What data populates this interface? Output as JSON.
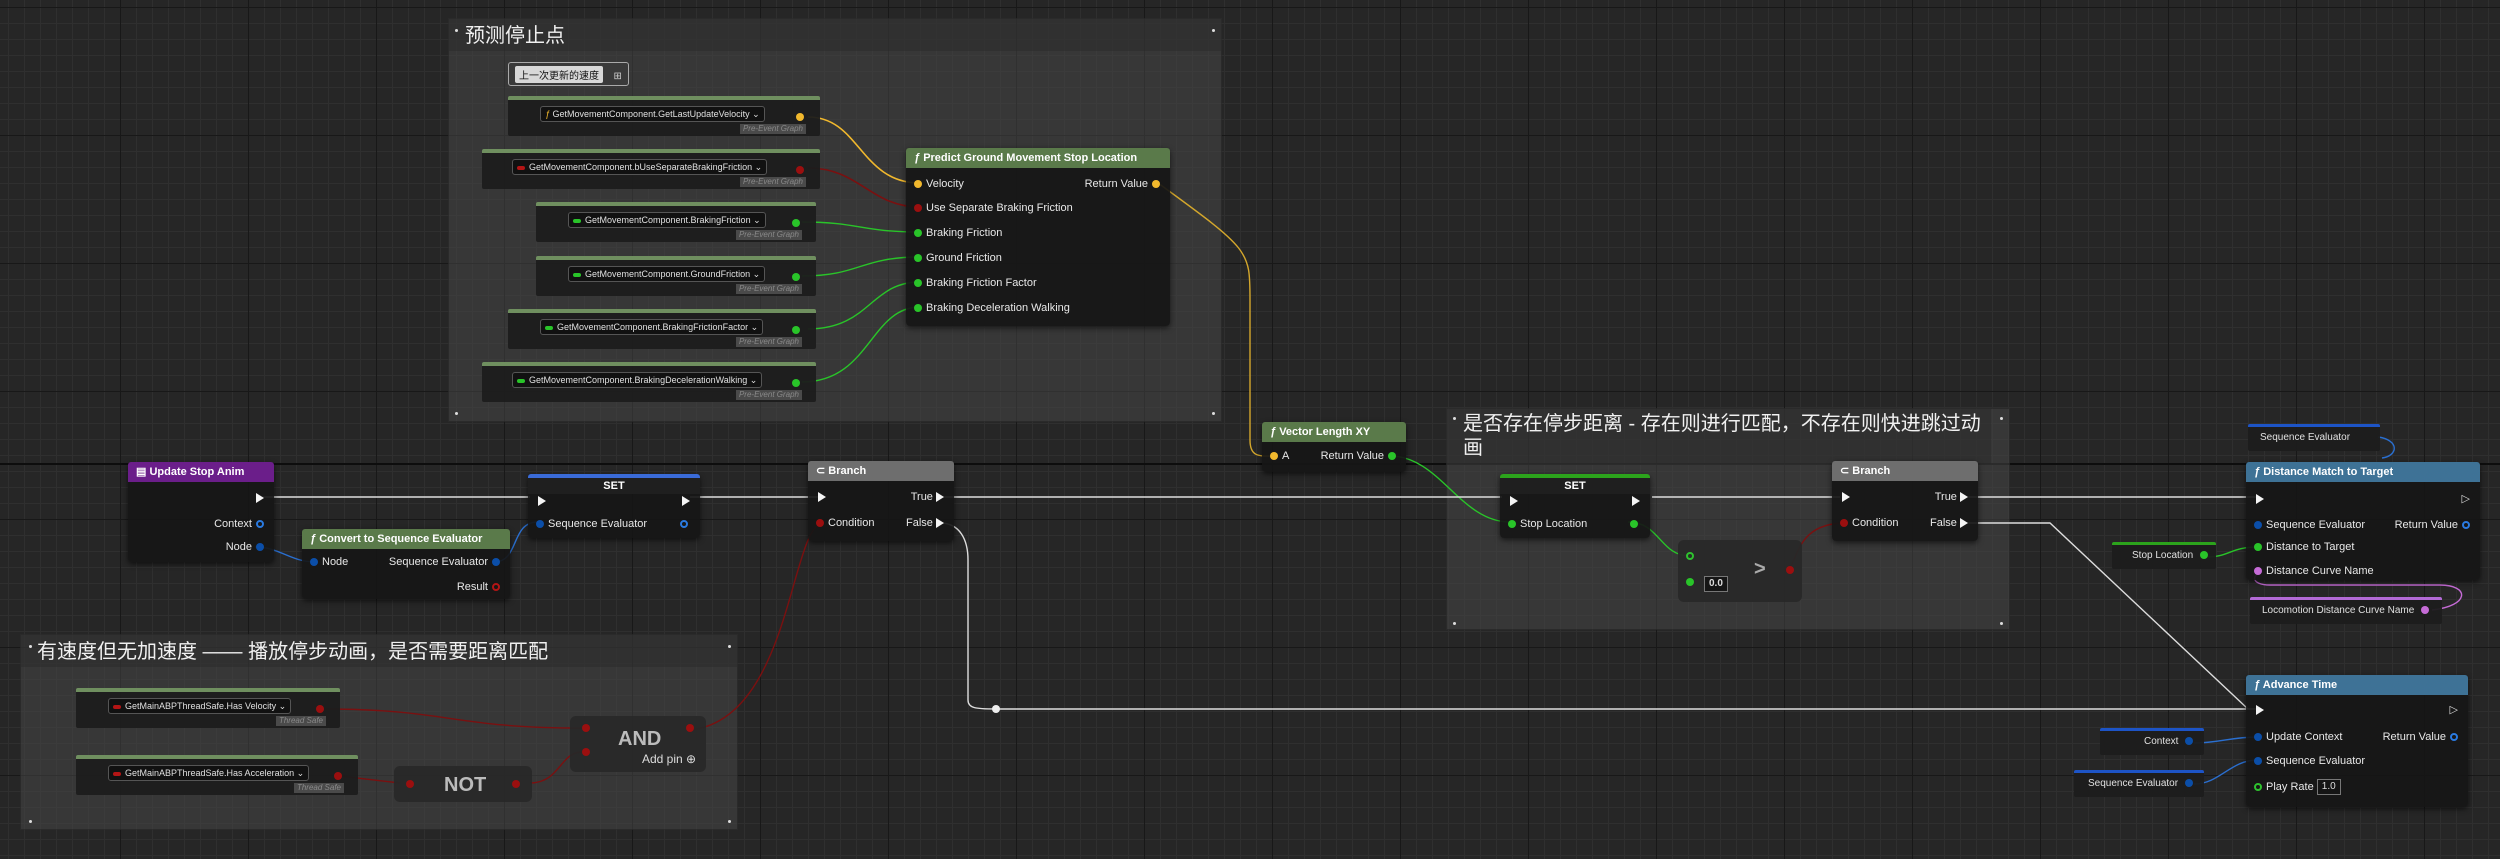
{
  "comments": {
    "predict": "预测停止点",
    "distance": "是否存在停步距离 - 存在则进行匹配，不存在则快进跳过动画",
    "speed": "有速度但无加速度 —— 播放停步动画，是否需要距离匹配"
  },
  "tooltip": "上一次更新的速度",
  "getters": {
    "velocity": "GetMovementComponent.GetLastUpdateVelocity",
    "separate": "GetMovementComponent.bUseSeparateBrakingFriction",
    "braking_friction": "GetMovementComponent.BrakingFriction",
    "ground_friction": "GetMovementComponent.GroundFriction",
    "friction_factor": "GetMovementComponent.BrakingFrictionFactor",
    "decel_walking": "GetMovementComponent.BrakingDecelerationWalking",
    "has_velocity": "GetMainABPThreadSafe.Has Velocity",
    "has_accel": "GetMainABPThreadSafe.Has Acceleration",
    "pre_event": "Pre-Event Graph",
    "thread_safe": "Thread Safe"
  },
  "predict_node": {
    "title": "Predict Ground Movement Stop Location",
    "inputs": [
      "Velocity",
      "Use Separate Braking Friction",
      "Braking Friction",
      "Ground Friction",
      "Braking Friction Factor",
      "Braking Deceleration Walking"
    ],
    "output": "Return Value"
  },
  "vector_length": {
    "title": "Vector Length XY",
    "input": "A",
    "output": "Return Value"
  },
  "update_stop": {
    "title": "Update Stop Anim",
    "context": "Context",
    "node": "Node"
  },
  "convert": {
    "title": "Convert to Sequence Evaluator",
    "node": "Node",
    "output": "Sequence Evaluator",
    "result": "Result"
  },
  "set1": {
    "title": "SET",
    "pin": "Sequence Evaluator"
  },
  "branch1": {
    "title": "Branch",
    "condition": "Condition",
    "true": "True",
    "false": "False"
  },
  "set2": {
    "title": "SET",
    "pin": "Stop Location"
  },
  "greater": {
    "symbol": ">",
    "value": "0.0"
  },
  "branch2": {
    "title": "Branch",
    "condition": "Condition",
    "true": "True",
    "false": "False"
  },
  "distance_match": {
    "title": "Distance Match to Target",
    "inputs": [
      "Sequence Evaluator",
      "Distance to Target",
      "Distance Curve Name"
    ],
    "output": "Return Value"
  },
  "advance_time": {
    "title": "Advance Time",
    "inputs": [
      "Update Context",
      "Sequence Evaluator",
      "Play Rate"
    ],
    "output": "Return Value",
    "play_rate": "1.0"
  },
  "reroutes": {
    "seq_eval_top": "Sequence Evaluator",
    "stop_location": "Stop Location",
    "curve_name": "Locomotion Distance Curve Name",
    "context": "Context",
    "seq_eval_bottom": "Sequence Evaluator"
  },
  "and_node": {
    "title": "AND",
    "add_pin": "Add pin"
  },
  "not_node": {
    "title": "NOT"
  },
  "colors": {
    "vector": "#f1b82d",
    "bool": "#9b0f0f",
    "float": "#29c429",
    "struct": "#0b4ea8",
    "name": "#c56bd6",
    "exec": "#ffffff"
  }
}
